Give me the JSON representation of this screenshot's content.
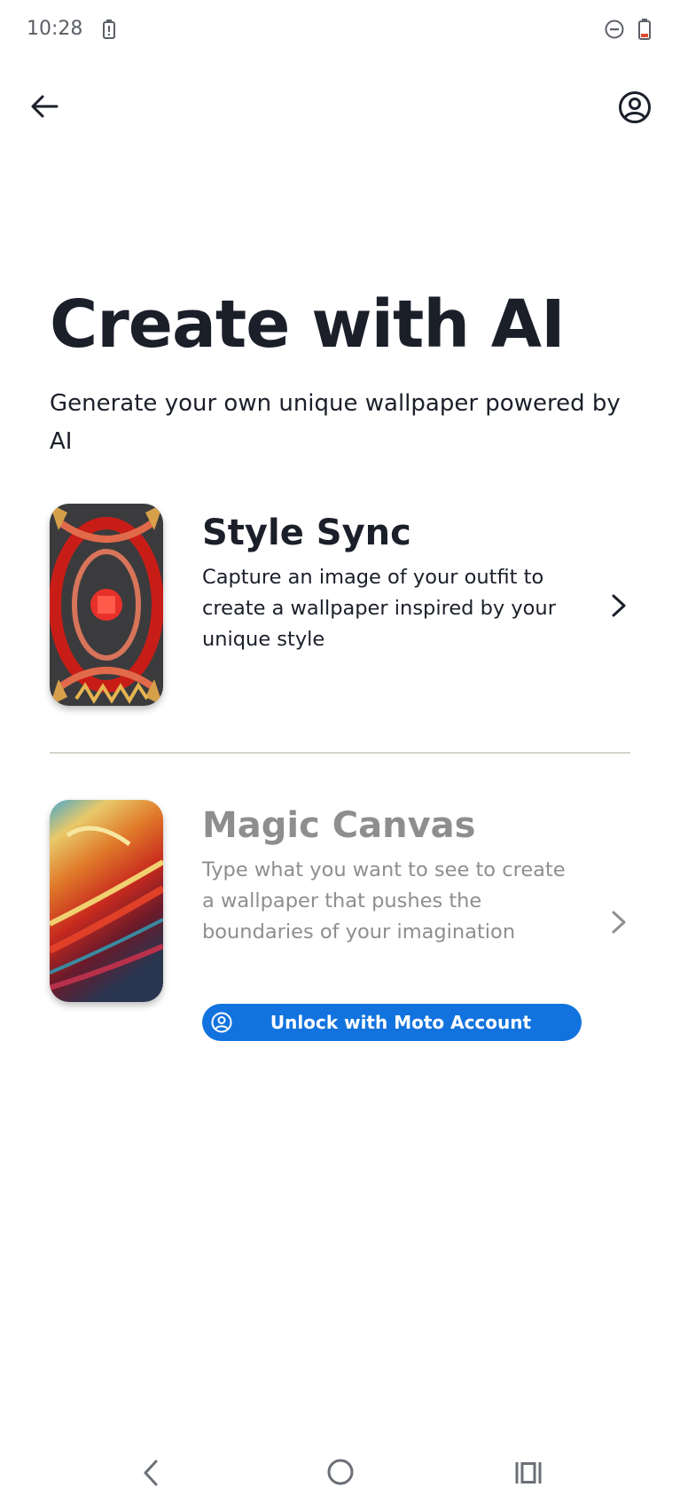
{
  "status_bar": {
    "time": "10:28",
    "icons": [
      "battery-alert-icon",
      "do-not-disturb-icon",
      "battery-low-icon"
    ]
  },
  "app_bar": {
    "back_icon": "arrow-left-icon",
    "account_icon": "account-circle-icon"
  },
  "header": {
    "title": "Create with AI",
    "subtitle": "Generate your own unique wallpaper powered by AI"
  },
  "features": [
    {
      "title": "Style Sync",
      "description": "Capture an image of your outfit to create a wallpaper inspired by your unique style",
      "enabled": true,
      "icon": "chevron-right-icon"
    },
    {
      "title": "Magic Canvas",
      "description": "Type what you want to see to create a wallpaper that pushes the boundaries of your imagination",
      "enabled": false,
      "icon": "chevron-right-icon",
      "unlock_button": {
        "label": "Unlock with Moto Account",
        "icon": "account-circle-icon"
      }
    }
  ],
  "nav_bar": {
    "icons": [
      "nav-back-icon",
      "nav-home-icon",
      "nav-recents-icon"
    ]
  },
  "colors": {
    "text_primary": "#1b1f2a",
    "text_disabled": "#8e8e8e",
    "accent": "#1273de",
    "divider": "#d6d4cc",
    "background": "#ffffff"
  }
}
